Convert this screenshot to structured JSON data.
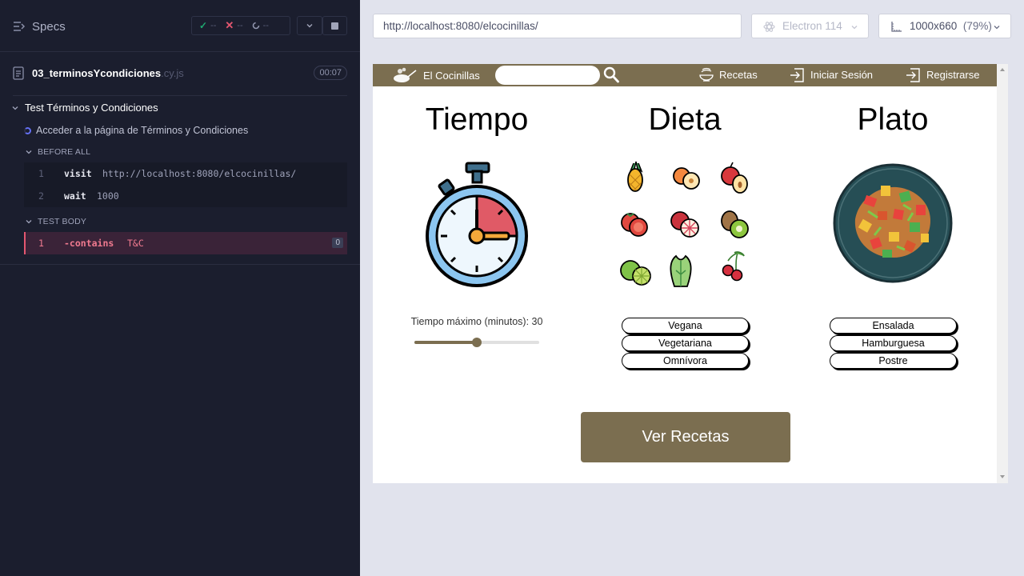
{
  "runner": {
    "specs_label": "Specs",
    "stats": {
      "passed": "--",
      "failed": "--",
      "pending": "--"
    },
    "spec_file": {
      "name": "03_terminosYcondiciones",
      "ext": ".cy.js",
      "duration": "00:07"
    },
    "suite_title": "Test Términos y Condiciones",
    "test_title": "Acceder a la página de Términos y Condiciones",
    "before_all_label": "BEFORE ALL",
    "before_all": [
      {
        "num": "1",
        "name": "visit",
        "arg": "http://localhost:8080/elcocinillas/"
      },
      {
        "num": "2",
        "name": "wait",
        "arg": "1000"
      }
    ],
    "test_body_label": "TEST BODY",
    "test_body": [
      {
        "num": "1",
        "name": "-contains",
        "arg": "T&C",
        "badge": "0"
      }
    ],
    "colors": {
      "bg": "#1b1e2e",
      "error": "#e45770",
      "pending": "#6470f3"
    }
  },
  "browser": {
    "url": "http://localhost:8080/elcocinillas/",
    "browser_name": "Electron 114",
    "viewport": "1000x660",
    "zoom": "(79%)"
  },
  "app": {
    "brand": "El Cocinillas",
    "search_placeholder": "",
    "nav": {
      "recipes": "Recetas",
      "login": "Iniciar Sesión",
      "register": "Registrarse"
    },
    "columns": {
      "tiempo": {
        "title": "Tiempo",
        "slider_label": "Tiempo máximo (minutos): 30",
        "slider_value": 30,
        "slider_fraction": 0.5
      },
      "dieta": {
        "title": "Dieta",
        "options": [
          "Vegana",
          "Vegetariana",
          "Omnívora"
        ]
      },
      "plato": {
        "title": "Plato",
        "options": [
          "Ensalada",
          "Hamburguesa",
          "Postre"
        ]
      }
    },
    "cta": "Ver Recetas",
    "colors": {
      "primary": "#7b6e50"
    }
  }
}
